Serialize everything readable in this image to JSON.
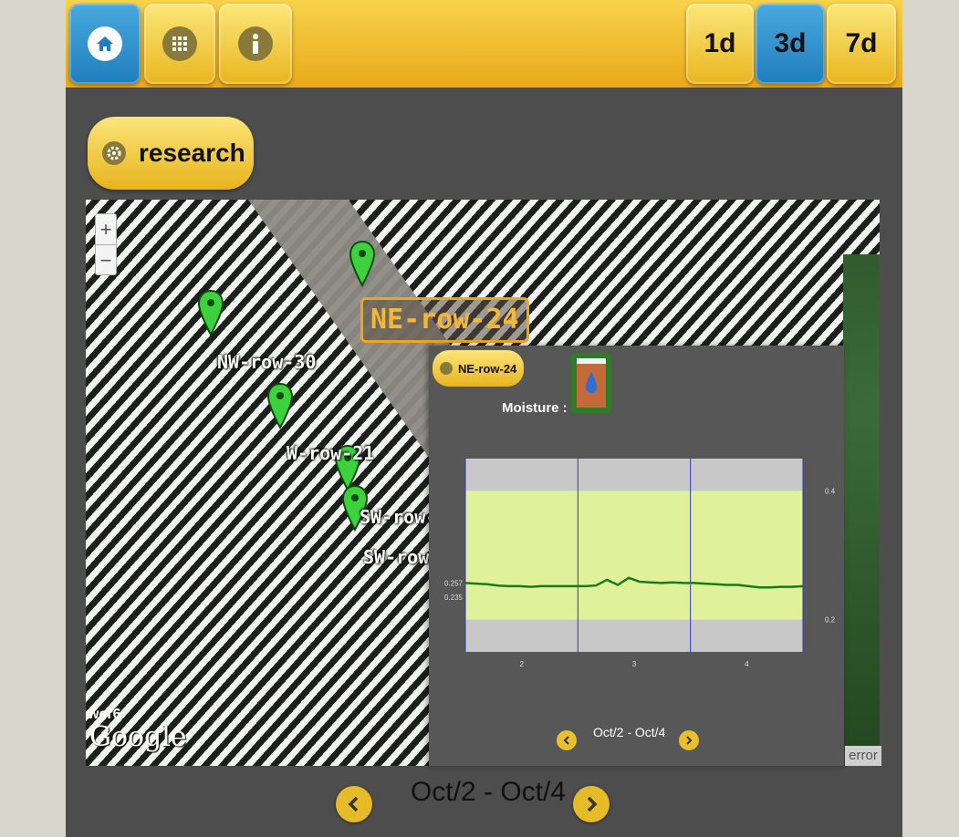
{
  "toolbar": {
    "buttons": [
      {
        "name": "home",
        "icon": "home-icon"
      },
      {
        "name": "apps",
        "icon": "grid-icon"
      },
      {
        "name": "info",
        "icon": "info-icon"
      }
    ],
    "ranges": [
      {
        "label": "1d",
        "active": false
      },
      {
        "label": "3d",
        "active": true
      },
      {
        "label": "7d",
        "active": false
      }
    ]
  },
  "research": {
    "label": "research",
    "icon": "gear-icon"
  },
  "map": {
    "zoom_in": "+",
    "zoom_out": "−",
    "markers": [
      "NW-row-30",
      "W-row-21",
      "SW-row-",
      "SW-row"
    ],
    "selected_marker": "NE-row-24",
    "watermark": "Google",
    "watermark_prefix": "wer6"
  },
  "popup": {
    "sensor_label": "NE-row-24",
    "metric_label": "Moisture :",
    "icon": "moisture-drop-icon",
    "date_range": "Oct/2 - Oct/4",
    "error_label": "error"
  },
  "chart_data": {
    "type": "line",
    "x_ticks": [
      "2",
      "3",
      "4"
    ],
    "left_ticks": [
      "0.257",
      "0.235"
    ],
    "right_ticks": [
      "0.4",
      "0.2"
    ],
    "series": [
      {
        "values": [
          0.257,
          0.256,
          0.255,
          0.253,
          0.252,
          0.252,
          0.251,
          0.252,
          0.252,
          0.252,
          0.252,
          0.252,
          0.253,
          0.262,
          0.254,
          0.265,
          0.259,
          0.258,
          0.257,
          0.258,
          0.257,
          0.257,
          0.256,
          0.255,
          0.254,
          0.254,
          0.252,
          0.25,
          0.25,
          0.251,
          0.251,
          0.252
        ]
      }
    ],
    "ylim": [
      0.15,
      0.45
    ],
    "band_green": [
      0.2,
      0.4
    ],
    "colors": {
      "line": "#1a7a1a",
      "band": "#dff29a",
      "outside": "#c8c8c8",
      "gridline": "#3333cc"
    }
  },
  "bottom": {
    "date_range": "Oct/2 - Oct/4"
  },
  "colors": {
    "accent": "#f2c232",
    "active": "#2d93cf",
    "panel": "#4d4d4d"
  }
}
